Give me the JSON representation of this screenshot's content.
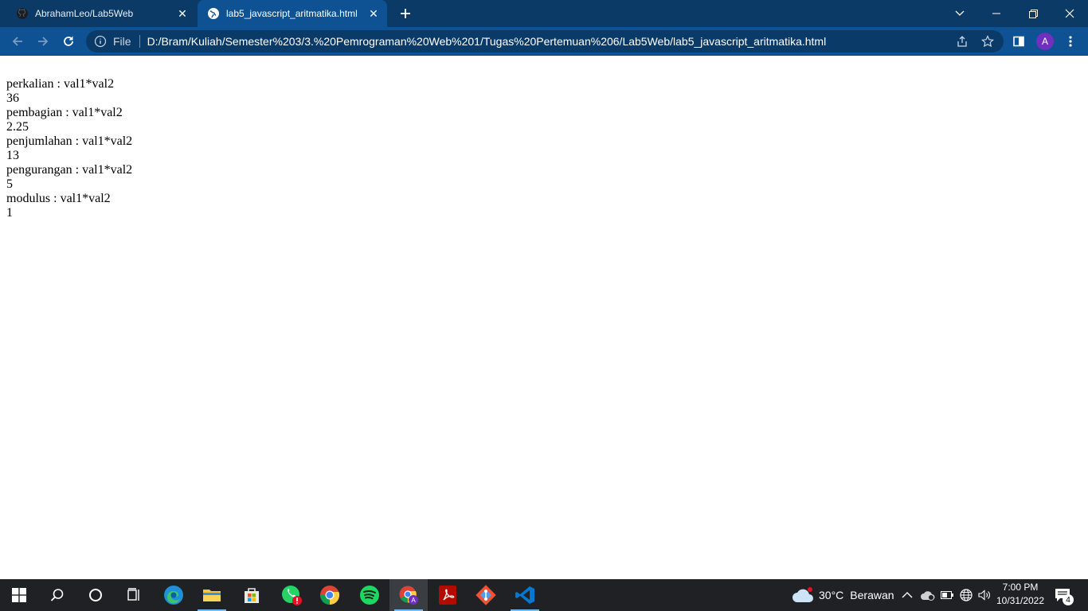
{
  "browser": {
    "tabs": [
      {
        "title": "AbrahamLeo/Lab5Web",
        "icon": "github-icon",
        "active": false
      },
      {
        "title": "lab5_javascript_aritmatika.html",
        "icon": "globe-icon",
        "active": true
      }
    ],
    "omnibox": {
      "scheme": "File",
      "url": "D:/Bram/Kuliah/Semester%203/3.%20Pemrograman%20Web%201/Tugas%20Pertemuan%206/Lab5Web/lab5_javascript_aritmatika.html"
    },
    "profile_initial": "A",
    "colors": {
      "tabstrip": "#0b3a66",
      "toolbar": "#0e5293",
      "omnibox": "#0a3a68"
    }
  },
  "page": {
    "lines": [
      "perkalian : val1*val2",
      "36",
      "pembagian : val1*val2",
      "2.25",
      "penjumlahan : val1*val2",
      "13",
      "pengurangan : val1*val2",
      "5",
      "modulus : val1*val2",
      "1"
    ]
  },
  "taskbar": {
    "apps": [
      "start",
      "search",
      "cortana",
      "task-view",
      "edge",
      "file-explorer",
      "microsoft-store",
      "whatsapp",
      "chrome",
      "spotify",
      "chrome-profile",
      "acrobat",
      "git",
      "vscode"
    ],
    "weather": {
      "temp": "30°C",
      "condition": "Berawan"
    },
    "clock": {
      "time": "7:00 PM",
      "date": "10/31/2022"
    },
    "notification_count": "4"
  }
}
